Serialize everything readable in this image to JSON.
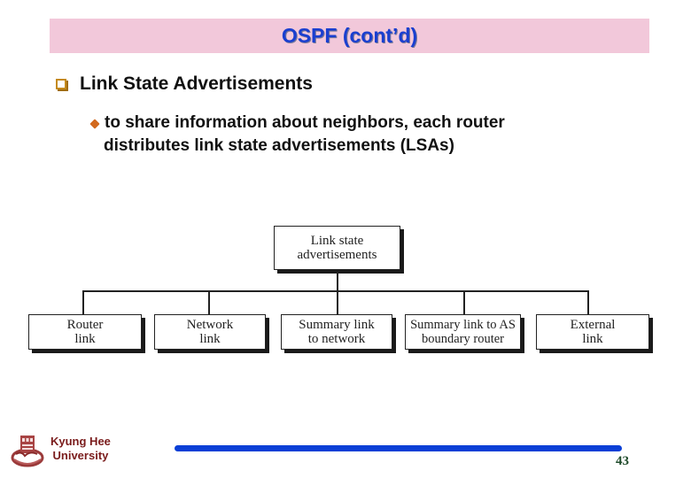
{
  "slide": {
    "title": "OSPF (cont’d)",
    "heading": "Link State Advertisements",
    "bullet": {
      "line1": "to share information about neighbors, each router",
      "line2": "distributes link state advertisements (LSAs)"
    }
  },
  "diagram": {
    "root": {
      "line1": "Link state",
      "line2": "advertisements"
    },
    "children": [
      {
        "line1": "Router",
        "line2": "link"
      },
      {
        "line1": "Network",
        "line2": "link"
      },
      {
        "line1": "Summary link",
        "line2": "to network"
      },
      {
        "line1": "Summary link to AS",
        "line2": "boundary router"
      },
      {
        "line1": "External",
        "line2": "link"
      }
    ]
  },
  "footer": {
    "university_line1": "Kyung Hee",
    "university_line2": "University",
    "page_number": "43",
    "logo_icon": "university-seal-icon"
  },
  "colors": {
    "title_band": "#f2c8da",
    "title_text": "#1a3fd0",
    "footer_bar": "#0a3fd6",
    "university_text": "#7a1c1c",
    "page_number": "#1e4a2a"
  }
}
